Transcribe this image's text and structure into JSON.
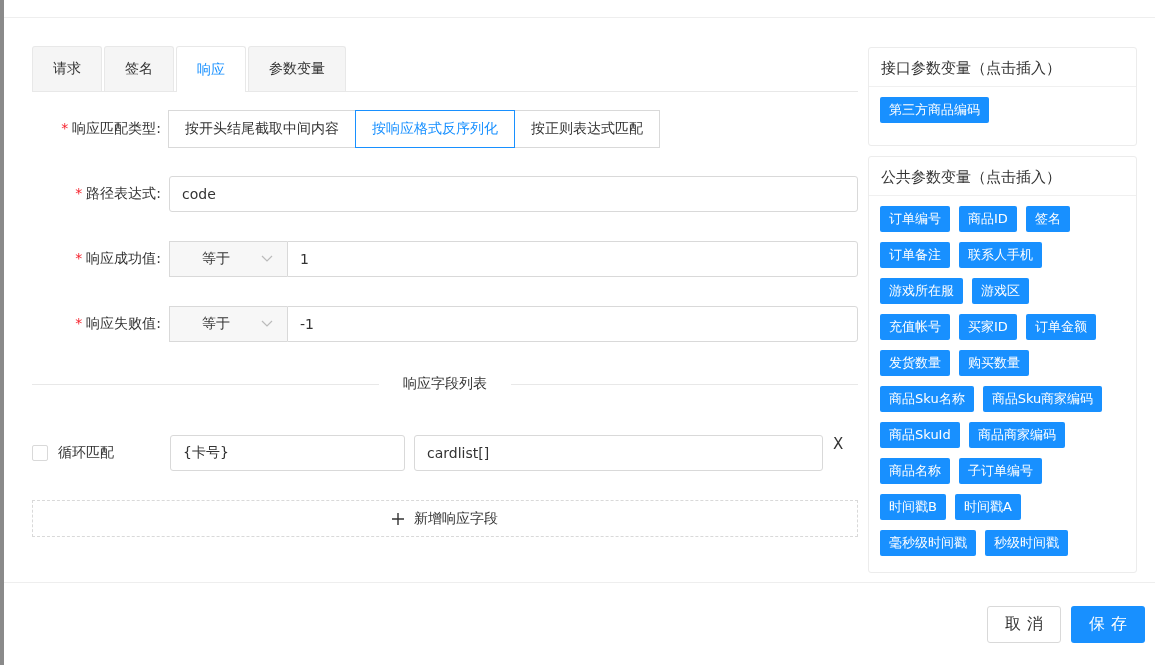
{
  "tabs": [
    {
      "label": "请求",
      "selected": false
    },
    {
      "label": "签名",
      "selected": false
    },
    {
      "label": "响应",
      "selected": true
    },
    {
      "label": "参数变量",
      "selected": false
    }
  ],
  "match_type": {
    "label": "响应匹配类型:",
    "required_mark": "*",
    "options": [
      {
        "label": "按开头结尾截取中间内容",
        "selected": false
      },
      {
        "label": "按响应格式反序列化",
        "selected": true
      },
      {
        "label": "按正则表达式匹配",
        "selected": false
      }
    ]
  },
  "path_expression": {
    "label": "路径表达式:",
    "required_mark": "*",
    "value": "code"
  },
  "success_value": {
    "label": "响应成功值:",
    "required_mark": "*",
    "operator": "等于",
    "value": "1"
  },
  "failure_value": {
    "label": "响应失败值:",
    "required_mark": "*",
    "operator": "等于",
    "value": "-1"
  },
  "field_list": {
    "title": "响应字段列表",
    "rows": [
      {
        "loop_label": "循环匹配",
        "checked": false,
        "name": "{卡号}",
        "path": "cardlist[]",
        "remove": "X"
      }
    ],
    "add_button": "新增响应字段"
  },
  "interface_vars": {
    "title": "接口参数变量（点击插入）",
    "rows": [
      [
        "第三方商品编码"
      ]
    ]
  },
  "public_vars": {
    "title": "公共参数变量（点击插入）",
    "rows": [
      [
        "订单编号",
        "商品ID",
        "签名"
      ],
      [
        "订单备注",
        "联系人手机"
      ],
      [
        "游戏所在服",
        "游戏区"
      ],
      [
        "充值帐号",
        "买家ID",
        "订单金额"
      ],
      [
        "发货数量",
        "购买数量"
      ],
      [
        "商品Sku名称",
        "商品Sku商家编码"
      ],
      [
        "商品SkuId",
        "商品商家编码"
      ],
      [
        "商品名称",
        "子订单编号"
      ],
      [
        "时间戳B",
        "时间戳A"
      ],
      [
        "毫秒级时间戳",
        "秒级时间戳"
      ]
    ]
  },
  "footer": {
    "cancel": "取 消",
    "save": "保 存"
  }
}
